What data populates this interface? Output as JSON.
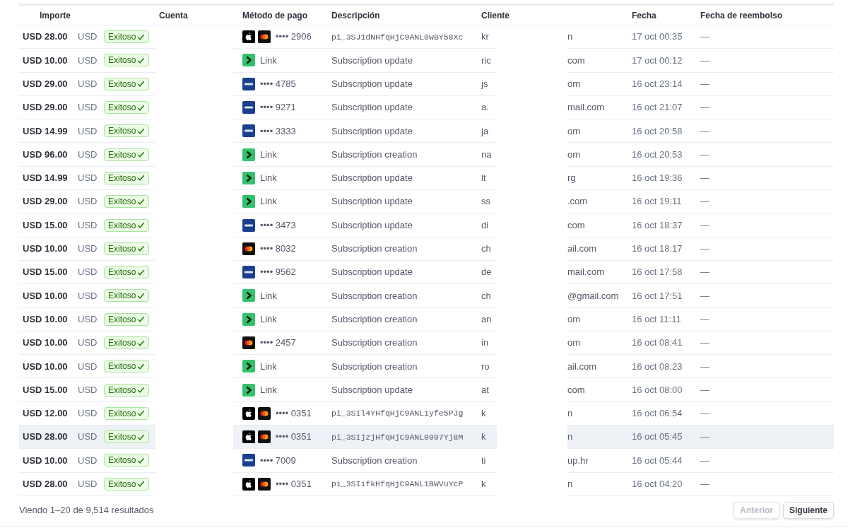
{
  "table": {
    "columns": [
      "Importe",
      "Cuenta",
      "Método de pago",
      "Descripción",
      "Cliente",
      "Fecha",
      "Fecha de reembolso"
    ],
    "rows": [
      {
        "amount": "USD 28.00",
        "currency": "USD",
        "status": "Exitoso",
        "method": {
          "kind": "apple_mastercard",
          "text": "•••• 2906"
        },
        "description": {
          "kind": "id",
          "text": "pi_3SJ1dNHfqHjC9ANL0wBY58Xc"
        },
        "client_start": "kr",
        "client_end": "n",
        "date": "17 oct 00:35",
        "refund_date": "—",
        "hovered": false
      },
      {
        "amount": "USD 10.00",
        "currency": "USD",
        "status": "Exitoso",
        "method": {
          "kind": "link",
          "text": "Link"
        },
        "description": {
          "kind": "text",
          "text": "Subscription update"
        },
        "client_start": "ric",
        "client_end": "com",
        "date": "17 oct 00:12",
        "refund_date": "—",
        "hovered": false
      },
      {
        "amount": "USD 29.00",
        "currency": "USD",
        "status": "Exitoso",
        "method": {
          "kind": "visa",
          "text": "•••• 4785"
        },
        "description": {
          "kind": "text",
          "text": "Subscription update"
        },
        "client_start": "js",
        "client_end": "om",
        "date": "16 oct 23:14",
        "refund_date": "—",
        "hovered": false
      },
      {
        "amount": "USD 29.00",
        "currency": "USD",
        "status": "Exitoso",
        "method": {
          "kind": "visa",
          "text": "•••• 9271"
        },
        "description": {
          "kind": "text",
          "text": "Subscription update"
        },
        "client_start": "a.",
        "client_end": "mail.com",
        "date": "16 oct 21:07",
        "refund_date": "—",
        "hovered": false
      },
      {
        "amount": "USD 14.99",
        "currency": "USD",
        "status": "Exitoso",
        "method": {
          "kind": "visa",
          "text": "•••• 3333"
        },
        "description": {
          "kind": "text",
          "text": "Subscription update"
        },
        "client_start": "ja",
        "client_end": "om",
        "date": "16 oct 20:58",
        "refund_date": "—",
        "hovered": false
      },
      {
        "amount": "USD 96.00",
        "currency": "USD",
        "status": "Exitoso",
        "method": {
          "kind": "link",
          "text": "Link"
        },
        "description": {
          "kind": "text",
          "text": "Subscription creation"
        },
        "client_start": "na",
        "client_end": "om",
        "date": "16 oct 20:53",
        "refund_date": "—",
        "hovered": false
      },
      {
        "amount": "USD 14.99",
        "currency": "USD",
        "status": "Exitoso",
        "method": {
          "kind": "link",
          "text": "Link"
        },
        "description": {
          "kind": "text",
          "text": "Subscription update"
        },
        "client_start": "lt",
        "client_end": "rg",
        "date": "16 oct 19:36",
        "refund_date": "—",
        "hovered": false
      },
      {
        "amount": "USD 29.00",
        "currency": "USD",
        "status": "Exitoso",
        "method": {
          "kind": "link",
          "text": "Link"
        },
        "description": {
          "kind": "text",
          "text": "Subscription update"
        },
        "client_start": "ss",
        "client_end": ".com",
        "date": "16 oct 19:11",
        "refund_date": "—",
        "hovered": false
      },
      {
        "amount": "USD 15.00",
        "currency": "USD",
        "status": "Exitoso",
        "method": {
          "kind": "visa",
          "text": "•••• 3473"
        },
        "description": {
          "kind": "text",
          "text": "Subscription update"
        },
        "client_start": "di",
        "client_end": "com",
        "date": "16 oct 18:37",
        "refund_date": "—",
        "hovered": false
      },
      {
        "amount": "USD 10.00",
        "currency": "USD",
        "status": "Exitoso",
        "method": {
          "kind": "mastercard",
          "text": "•••• 8032"
        },
        "description": {
          "kind": "text",
          "text": "Subscription creation"
        },
        "client_start": "ch",
        "client_end": "ail.com",
        "date": "16 oct 18:17",
        "refund_date": "—",
        "hovered": false
      },
      {
        "amount": "USD 15.00",
        "currency": "USD",
        "status": "Exitoso",
        "method": {
          "kind": "visa",
          "text": "•••• 9562"
        },
        "description": {
          "kind": "text",
          "text": "Subscription update"
        },
        "client_start": "de",
        "client_end": "mail.com",
        "date": "16 oct 17:58",
        "refund_date": "—",
        "hovered": false
      },
      {
        "amount": "USD 10.00",
        "currency": "USD",
        "status": "Exitoso",
        "method": {
          "kind": "link",
          "text": "Link"
        },
        "description": {
          "kind": "text",
          "text": "Subscription creation"
        },
        "client_start": "ch",
        "client_end": "@gmail.com",
        "date": "16 oct 17:51",
        "refund_date": "—",
        "hovered": false
      },
      {
        "amount": "USD 10.00",
        "currency": "USD",
        "status": "Exitoso",
        "method": {
          "kind": "link",
          "text": "Link"
        },
        "description": {
          "kind": "text",
          "text": "Subscription creation"
        },
        "client_start": "an",
        "client_end": "om",
        "date": "16 oct 11:11",
        "refund_date": "—",
        "hovered": false
      },
      {
        "amount": "USD 10.00",
        "currency": "USD",
        "status": "Exitoso",
        "method": {
          "kind": "mastercard",
          "text": "•••• 2457"
        },
        "description": {
          "kind": "text",
          "text": "Subscription creation"
        },
        "client_start": "in",
        "client_end": "om",
        "date": "16 oct 08:41",
        "refund_date": "—",
        "hovered": false
      },
      {
        "amount": "USD 10.00",
        "currency": "USD",
        "status": "Exitoso",
        "method": {
          "kind": "link",
          "text": "Link"
        },
        "description": {
          "kind": "text",
          "text": "Subscription creation"
        },
        "client_start": "ro",
        "client_end": "ail.com",
        "date": "16 oct 08:23",
        "refund_date": "—",
        "hovered": false
      },
      {
        "amount": "USD 15.00",
        "currency": "USD",
        "status": "Exitoso",
        "method": {
          "kind": "link",
          "text": "Link"
        },
        "description": {
          "kind": "text",
          "text": "Subscription update"
        },
        "client_start": "at",
        "client_end": "com",
        "date": "16 oct 08:00",
        "refund_date": "—",
        "hovered": false
      },
      {
        "amount": "USD 12.00",
        "currency": "USD",
        "status": "Exitoso",
        "method": {
          "kind": "apple_mastercard",
          "text": "•••• 0351"
        },
        "description": {
          "kind": "id",
          "text": "pi_3SIl4YHfqHjC9ANL1yfe5PJg"
        },
        "client_start": "k",
        "client_end": "n",
        "date": "16 oct 06:54",
        "refund_date": "—",
        "hovered": false
      },
      {
        "amount": "USD 28.00",
        "currency": "USD",
        "status": "Exitoso",
        "method": {
          "kind": "apple_mastercard",
          "text": "•••• 0351"
        },
        "description": {
          "kind": "id",
          "text": "pi_3SIjzjHfqHjC9ANL0007Yj8M"
        },
        "client_start": "k",
        "client_end": "n",
        "date": "16 oct 05:45",
        "refund_date": "—",
        "hovered": true
      },
      {
        "amount": "USD 10.00",
        "currency": "USD",
        "status": "Exitoso",
        "method": {
          "kind": "visa",
          "text": "•••• 7009"
        },
        "description": {
          "kind": "text",
          "text": "Subscription creation"
        },
        "client_start": "ti",
        "client_end": "up.hr",
        "date": "16 oct 05:44",
        "refund_date": "—",
        "hovered": false
      },
      {
        "amount": "USD 28.00",
        "currency": "USD",
        "status": "Exitoso",
        "method": {
          "kind": "apple_mastercard",
          "text": "•••• 0351"
        },
        "description": {
          "kind": "id",
          "text": "pi_3SIifkHfqHjC9ANL1BWVuYcP"
        },
        "client_start": "k",
        "client_end": "n",
        "date": "16 oct 04:20",
        "refund_date": "—",
        "hovered": false
      }
    ]
  },
  "footer": {
    "summary": "Viendo 1–20 de 9,514 resultados",
    "buttons": [
      {
        "label": "Anterior",
        "disabled": true
      },
      {
        "label": "Siguiente",
        "disabled": false
      }
    ]
  }
}
